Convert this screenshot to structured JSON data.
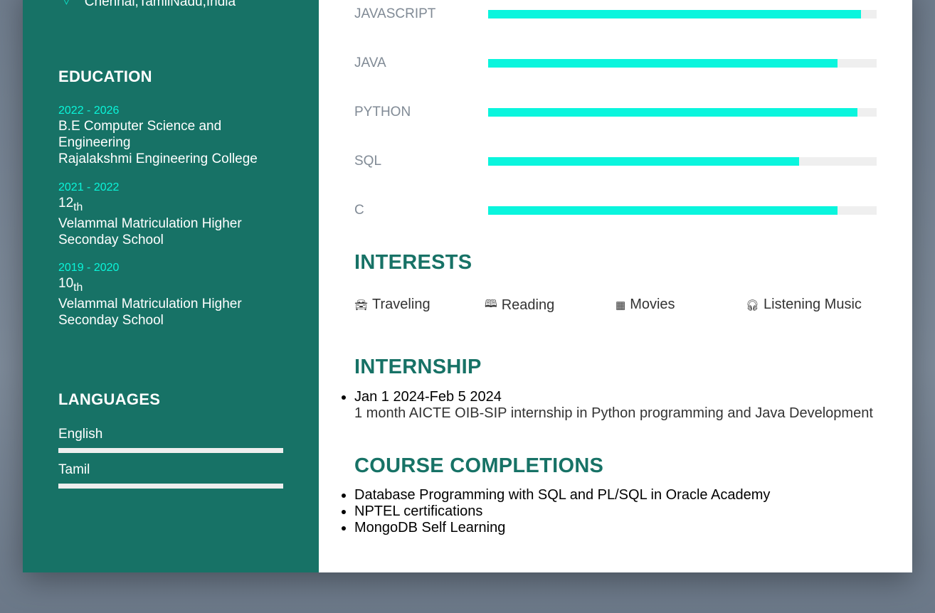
{
  "sidebar": {
    "location": "Chennai,TamilNadu,India",
    "education_title": "EDUCATION",
    "education": [
      {
        "years": "2022 - 2026",
        "degree": "B.E Computer Science and Engineering",
        "school": "Rajalakshmi Engineering College"
      },
      {
        "years": "2021 - 2022",
        "grade": "12",
        "suffix": "th",
        "school": "Velammal Matriculation Higher Seconday School"
      },
      {
        "years": "2019 - 2020",
        "grade": "10",
        "suffix": "th",
        "school": "Velammal Matriculation Higher Seconday School"
      }
    ],
    "languages_title": "LANGUAGES",
    "languages": [
      {
        "name": "English",
        "level": 100
      },
      {
        "name": "Tamil",
        "level": 100
      }
    ]
  },
  "skills": [
    {
      "name": "JAVASCRIPT",
      "percent": 96
    },
    {
      "name": "JAVA",
      "percent": 90
    },
    {
      "name": "PYTHON",
      "percent": 95
    },
    {
      "name": "SQL",
      "percent": 80
    },
    {
      "name": "C",
      "percent": 90
    }
  ],
  "interests": {
    "title": "INTERESTS",
    "items": [
      {
        "icon": "car-icon",
        "label": "Traveling"
      },
      {
        "icon": "book-icon",
        "label": "Reading"
      },
      {
        "icon": "film-icon",
        "label": "Movies"
      },
      {
        "icon": "headphones-icon",
        "label": "Listening Music"
      }
    ]
  },
  "internship": {
    "title": "INTERNSHIP",
    "date": "Jan 1 2024-Feb 5 2024",
    "desc": "1 month AICTE OIB-SIP internship in Python programming and Java Development"
  },
  "courses": {
    "title": "COURSE COMPLETIONS",
    "items": [
      "Database Programming with SQL and PL/SQL in Oracle Academy",
      "NPTEL certifications",
      "MongoDB Self Learning"
    ]
  },
  "colors": {
    "primary": "#177266",
    "accent": "#0af5dd"
  }
}
